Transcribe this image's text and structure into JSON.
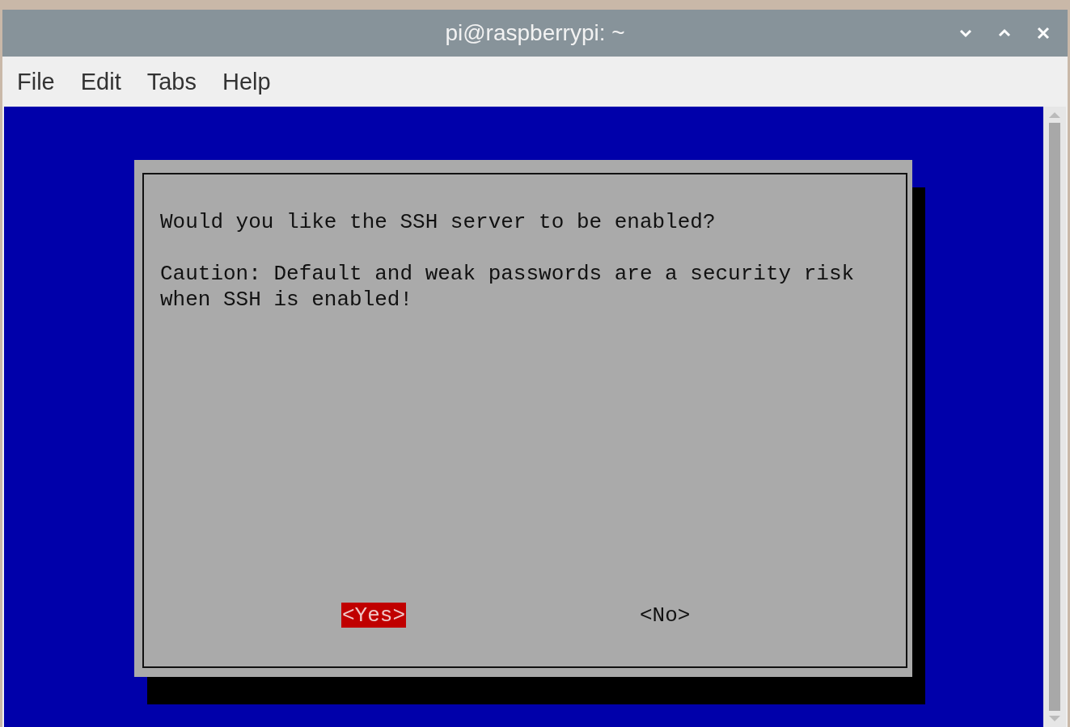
{
  "window": {
    "title": "pi@raspberrypi: ~"
  },
  "menu": [
    "File",
    "Edit",
    "Tabs",
    "Help"
  ],
  "dialog": {
    "paragraphs": [
      [
        "Would you like the SSH server to be enabled?"
      ],
      [
        "Caution: Default and weak passwords are a security risk",
        "when SSH is enabled!"
      ]
    ],
    "buttons": [
      {
        "label": "<Yes>",
        "selected": true
      },
      {
        "label": "<No>",
        "selected": false
      }
    ]
  }
}
